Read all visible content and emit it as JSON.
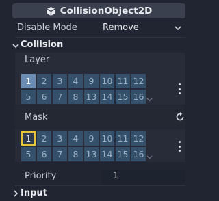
{
  "header": {
    "title": "CollisionObject2D",
    "icon": "node-cube-icon"
  },
  "disable_mode": {
    "label": "Disable Mode",
    "value": "Remove"
  },
  "collision": {
    "title": "Collision",
    "layer": {
      "label": "Layer",
      "row1": [
        "1",
        "2",
        "3",
        "4",
        "9",
        "10",
        "11",
        "12"
      ],
      "row2": [
        "5",
        "6",
        "7",
        "8",
        "13",
        "14",
        "15",
        "16"
      ]
    },
    "mask": {
      "label": "Mask",
      "row1": [
        "1",
        "2",
        "3",
        "4",
        "9",
        "10",
        "11",
        "12"
      ],
      "row2": [
        "5",
        "6",
        "7",
        "8",
        "13",
        "14",
        "15",
        "16"
      ]
    },
    "priority": {
      "label": "Priority",
      "value": "1"
    }
  },
  "input": {
    "title": "Input"
  },
  "colors": {
    "accent": "#6b8db4",
    "mask_selected_border": "#e8c33a"
  }
}
